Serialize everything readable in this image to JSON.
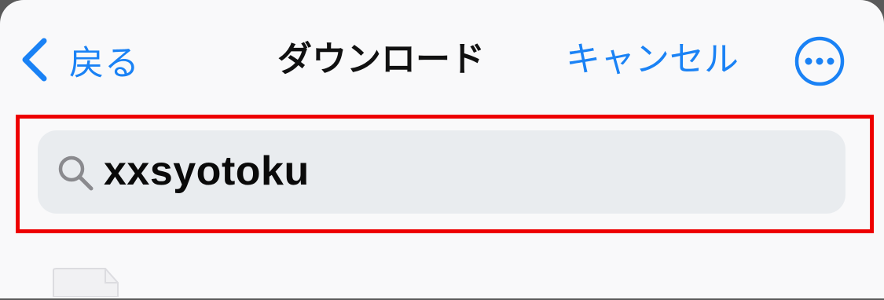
{
  "navbar": {
    "back_label": "戻る",
    "title": "ダウンロード",
    "cancel_label": "キャンセル",
    "more_icon": "ellipsis-circle-icon",
    "back_icon": "chevron-left-icon"
  },
  "search": {
    "icon": "search-icon",
    "value": "xxsyotoku",
    "highlighted": true
  },
  "file_list": {
    "first_item_icon": "document-icon"
  },
  "colors": {
    "accent": "#1a82f5",
    "highlight_border": "#ee0000",
    "search_background": "#e9ecef",
    "sheet_background": "#f9f9fa"
  }
}
